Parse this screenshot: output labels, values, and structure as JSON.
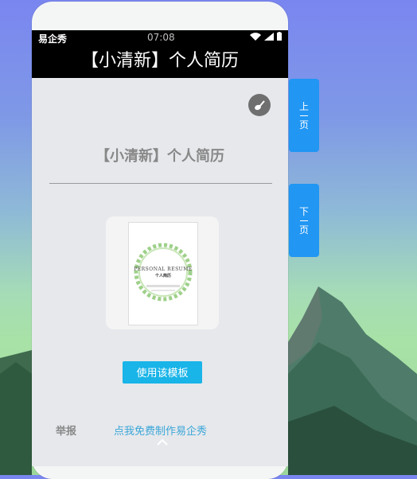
{
  "status_bar": {
    "carrier": "易企秀",
    "time": "07:08"
  },
  "title_bar": {
    "title": "【小清新】个人简历"
  },
  "content": {
    "heading": "【小清新】个人简历",
    "thumbnail": {
      "doc_title": "PERSONAL RESUME",
      "doc_subtitle": "个人简历"
    },
    "use_button": "使用该模板",
    "report_link": "举报",
    "promo_link": "点我免费制作易企秀"
  },
  "nav": {
    "prev": {
      "top": "上",
      "bottom": "页"
    },
    "next": {
      "top": "下",
      "bottom": "页"
    }
  },
  "colors": {
    "accent": "#19b4e8",
    "side_button": "#2196f3",
    "link": "#3aa6d8"
  },
  "icons": [
    "wifi-icon",
    "signal-icon",
    "battery-icon",
    "music-icon",
    "chevron-up-icon"
  ]
}
